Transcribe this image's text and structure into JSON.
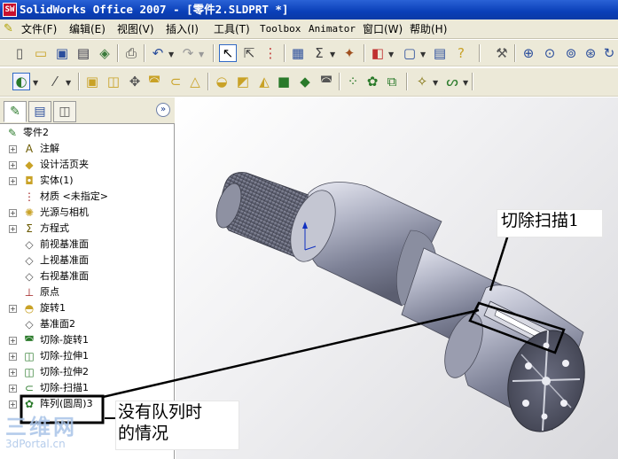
{
  "window": {
    "title": "SolidWorks Office 2007 - [零件2.SLDPRT *]",
    "logo_text": "SW"
  },
  "menu": {
    "items": [
      "文件(F)",
      "编辑(E)",
      "视图(V)",
      "插入(I)",
      "工具(T)",
      "Toolbox",
      "Animator",
      "窗口(W)",
      "帮助(H)"
    ]
  },
  "panel": {
    "tabs": [
      {
        "name": "feature-manager",
        "icon": "feature-tree-icon"
      },
      {
        "name": "property-manager",
        "icon": "property-icon"
      },
      {
        "name": "configuration-manager",
        "icon": "config-icon"
      }
    ],
    "expand_glyph": "»",
    "tree": [
      {
        "label": "零件2",
        "icon": "part-icon",
        "root": true,
        "expand": false
      },
      {
        "label": "注解",
        "icon": "annotation-icon",
        "expand": true
      },
      {
        "label": "设计活页夹",
        "icon": "design-binder-icon",
        "expand": true
      },
      {
        "label": "实体(1)",
        "icon": "solid-body-icon",
        "expand": true
      },
      {
        "label": "材质 <未指定>",
        "icon": "material-icon",
        "expand": false
      },
      {
        "label": "光源与相机",
        "icon": "lights-icon",
        "expand": true
      },
      {
        "label": "方程式",
        "icon": "equation-icon",
        "expand": true
      },
      {
        "label": "前视基准面",
        "icon": "plane-icon",
        "expand": false
      },
      {
        "label": "上视基准面",
        "icon": "plane-icon",
        "expand": false
      },
      {
        "label": "右视基准面",
        "icon": "plane-icon",
        "expand": false
      },
      {
        "label": "原点",
        "icon": "origin-icon",
        "expand": false
      },
      {
        "label": "旋转1",
        "icon": "revolve-icon",
        "expand": true
      },
      {
        "label": "基准面2",
        "icon": "plane-icon",
        "expand": false
      },
      {
        "label": "切除-旋转1",
        "icon": "cut-revolve-icon",
        "expand": true
      },
      {
        "label": "切除-拉伸1",
        "icon": "cut-extrude-icon",
        "expand": true
      },
      {
        "label": "切除-拉伸2",
        "icon": "cut-extrude-icon",
        "expand": true
      },
      {
        "label": "切除-扫描1",
        "icon": "cut-sweep-icon",
        "expand": true
      },
      {
        "label": "阵列(圆周)3",
        "icon": "circular-pattern-icon",
        "expand": true
      }
    ]
  },
  "callouts": {
    "sweep": "切除扫描1",
    "no_pattern_line1": "没有队列时",
    "no_pattern_line2": "的情况"
  },
  "watermark": {
    "brand": "三维网",
    "url": "3dPortal.cn"
  },
  "colors": {
    "titlebar": "#0a3fb8",
    "chrome": "#ece9d8",
    "part": "#8a8ea0",
    "accent": "#000000"
  }
}
